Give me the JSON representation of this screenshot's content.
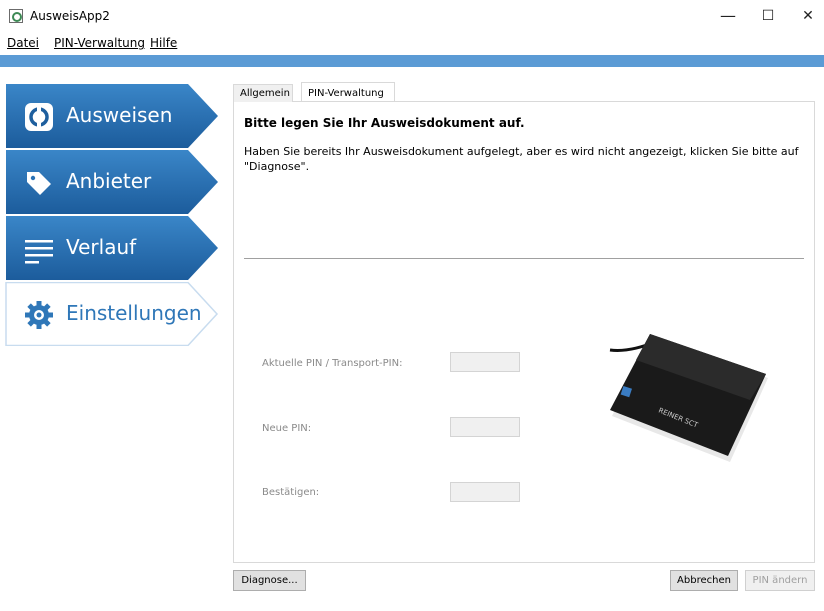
{
  "window": {
    "title": "AusweisApp2",
    "minimize_glyph": "—",
    "maximize_glyph": "☐",
    "close_glyph": "✕"
  },
  "menubar": {
    "items": [
      "Datei",
      "PIN-Verwaltung",
      "Hilfe"
    ]
  },
  "accent_color": "#5b9bd5",
  "nav": {
    "items": [
      {
        "label": "Ausweisen",
        "icon": "ausweisen-ring-icon",
        "active": true
      },
      {
        "label": "Anbieter",
        "icon": "tag-icon",
        "active": true
      },
      {
        "label": "Verlauf",
        "icon": "list-lines-icon",
        "active": true
      },
      {
        "label": "Einstellungen",
        "icon": "gear-icon",
        "active": false
      }
    ]
  },
  "tabs": [
    "Allgemein",
    "PIN-Verwaltung"
  ],
  "selected_tab": "PIN-Verwaltung",
  "main": {
    "heading": "Bitte legen Sie Ihr Ausweisdokument auf.",
    "body": "Haben Sie bereits Ihr Ausweisdokument aufgelegt, aber es wird nicht angezeigt, klicken Sie bitte auf \"Diagnose\"."
  },
  "form": {
    "current_pin_label": "Aktuelle PIN / Transport-PIN:",
    "current_pin_value": "",
    "new_pin_label": "Neue PIN:",
    "new_pin_value": "",
    "confirm_label": "Bestätigen:",
    "confirm_value": ""
  },
  "reader": {
    "brand": "REINER SCT"
  },
  "buttons": {
    "diagnose": "Diagnose...",
    "cancel": "Abbrechen",
    "change_pin": "PIN ändern"
  }
}
